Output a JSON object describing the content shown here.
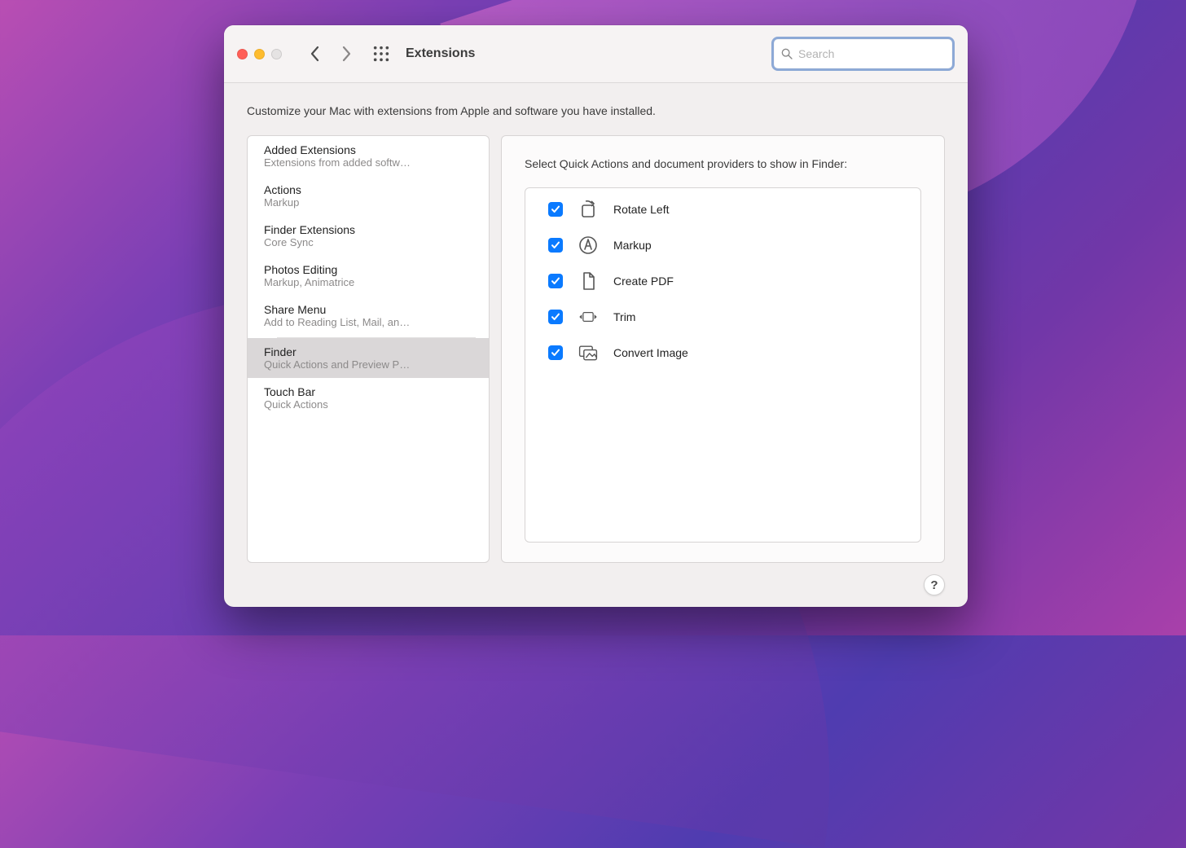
{
  "toolbar": {
    "title": "Extensions",
    "search_placeholder": "Search"
  },
  "description": "Customize your Mac with extensions from Apple and software you have installed.",
  "sidebar": {
    "items": [
      {
        "title": "Added Extensions",
        "subtitle": "Extensions from added softw…",
        "selected": false
      },
      {
        "title": "Actions",
        "subtitle": "Markup",
        "selected": false
      },
      {
        "title": "Finder Extensions",
        "subtitle": "Core Sync",
        "selected": false
      },
      {
        "title": "Photos Editing",
        "subtitle": "Markup, Animatrice",
        "selected": false
      },
      {
        "title": "Share Menu",
        "subtitle": "Add to Reading List, Mail, an…",
        "selected": false
      },
      {
        "title": "Finder",
        "subtitle": "Quick Actions and Preview P…",
        "selected": true
      },
      {
        "title": "Touch Bar",
        "subtitle": "Quick Actions",
        "selected": false
      }
    ]
  },
  "detail": {
    "header": "Select Quick Actions and document providers to show in Finder:",
    "actions": [
      {
        "label": "Rotate Left",
        "checked": true,
        "icon": "rotate-left-icon"
      },
      {
        "label": "Markup",
        "checked": true,
        "icon": "markup-icon"
      },
      {
        "label": "Create PDF",
        "checked": true,
        "icon": "document-icon"
      },
      {
        "label": "Trim",
        "checked": true,
        "icon": "trim-icon"
      },
      {
        "label": "Convert Image",
        "checked": true,
        "icon": "convert-image-icon"
      }
    ]
  },
  "help_label": "?"
}
